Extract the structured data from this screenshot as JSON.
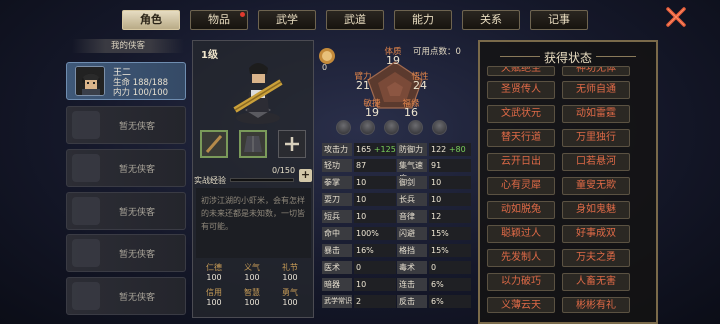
{
  "tabs": [
    {
      "label": "角色",
      "active": true
    },
    {
      "label": "物品",
      "active": false,
      "notify": true
    },
    {
      "label": "武学",
      "active": false
    },
    {
      "label": "武道",
      "active": false
    },
    {
      "label": "能力",
      "active": false
    },
    {
      "label": "关系",
      "active": false
    },
    {
      "label": "记事",
      "active": false
    }
  ],
  "roster": {
    "header": "我的侠客",
    "hero": {
      "name": "王二",
      "hp_line": "生命 188/188",
      "mp_line": "内力 100/100"
    },
    "empty_label": "暂无侠客",
    "empty_count": 5
  },
  "character": {
    "level": "1级",
    "exp_label": "实战经验",
    "exp_value": "0/150",
    "exp_progress": 0,
    "bio": "初涉江湖的小虾米，会有怎样的未来还都是未知数，一切皆有可能。",
    "virtues": [
      {
        "name": "仁德",
        "value": "100"
      },
      {
        "name": "义气",
        "value": "100"
      },
      {
        "name": "礼节",
        "value": "100"
      },
      {
        "name": "信用",
        "value": "100"
      },
      {
        "name": "智慧",
        "value": "100"
      },
      {
        "name": "勇气",
        "value": "100"
      }
    ]
  },
  "attributes": {
    "points_label": "可用点数：",
    "points_value": "0",
    "medal_value": "0",
    "items": [
      {
        "name": "体质",
        "value": "19"
      },
      {
        "name": "臂力",
        "value": "21"
      },
      {
        "name": "悟性",
        "value": "24"
      },
      {
        "name": "敏捷",
        "value": "19"
      },
      {
        "name": "福缘",
        "value": "16"
      }
    ]
  },
  "stats": [
    {
      "label": "攻击力",
      "value": "165",
      "bonus": "+125",
      "label2": "防御力",
      "value2": "122",
      "bonus2": "+80"
    },
    {
      "label": "轻功",
      "value": "87",
      "label2": "集气速度",
      "value2": "91"
    },
    {
      "label": "拳掌",
      "value": "10",
      "label2": "御剑",
      "value2": "10"
    },
    {
      "label": "耍刀",
      "value": "10",
      "label2": "长兵",
      "value2": "10"
    },
    {
      "label": "短兵",
      "value": "10",
      "label2": "音律",
      "value2": "12"
    },
    {
      "label": "命中",
      "value": "100%",
      "label2": "闪避",
      "value2": "15%"
    },
    {
      "label": "暴击",
      "value": "16%",
      "label2": "格挡",
      "value2": "15%"
    },
    {
      "label": "医术",
      "value": "0",
      "label2": "毒术",
      "value2": "0"
    },
    {
      "label": "暗器",
      "value": "10",
      "label2": "连击",
      "value2": "6%"
    },
    {
      "label": "武学常识",
      "value": "2",
      "label2": "反击",
      "value2": "6%"
    }
  ],
  "status_panel": {
    "title": "获得状态",
    "items": [
      "天赋绝圣",
      "神功无体",
      "圣贤传人",
      "无师自通",
      "文武状元",
      "动如雷霆",
      "替天行道",
      "万里独行",
      "云开日出",
      "口若悬河",
      "心有灵犀",
      "童叟无欺",
      "动如脱兔",
      "身如鬼魅",
      "聪颖过人",
      "好事成双",
      "先发制人",
      "万夫之勇",
      "以力破巧",
      "人畜无害",
      "义薄云天",
      "彬彬有礼"
    ]
  }
}
